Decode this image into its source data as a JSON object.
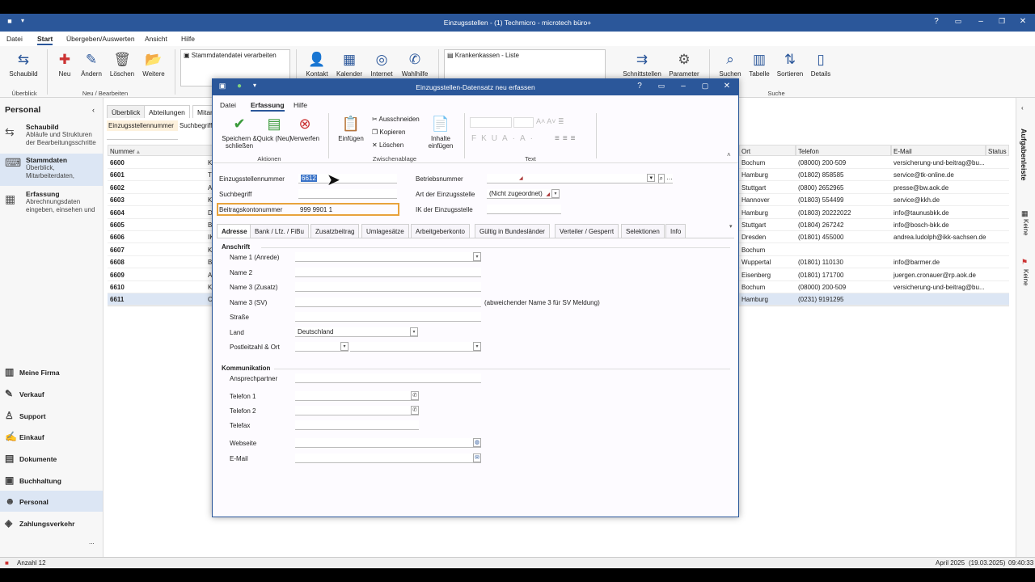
{
  "window": {
    "title": "Einzugsstellen - (1) Techmicro - microtech büro+",
    "help": "?"
  },
  "menu": {
    "items": [
      "Datei",
      "Start",
      "Übergeben/Auswerten",
      "Ansicht",
      "Hilfe"
    ]
  },
  "ribbon": {
    "schaubild": "Schaubild",
    "neu": "Neu",
    "aendern": "Ändern",
    "loeschen": "Löschen",
    "weitere": "Weitere",
    "group_ueberblick": "Überblick",
    "group_neu": "Neu / Bearbeiten",
    "listbox1_item": "Stammdatendatei verarbeiten",
    "kontakt": "Kontakt",
    "kalender": "Kalender",
    "internet": "Internet",
    "wahlhilfe": "Wahlhilfe",
    "listbox2_item": "Krankenkassen - Liste",
    "schnittstellen": "Schnittstellen",
    "parameter": "Parameter",
    "suchen": "Suchen",
    "tabelle": "Tabelle",
    "sortieren": "Sortieren",
    "details": "Details",
    "group_suche": "Suche"
  },
  "sidebar": {
    "heading": "Personal",
    "sections": [
      {
        "title": "Schaubild",
        "sub": "Abläufe und Strukturen der Bearbeitungsschritte"
      },
      {
        "title": "Stammdaten",
        "sub": "Überblick, Mitarbeiterdaten,"
      },
      {
        "title": "Erfassung",
        "sub": "Abrechnungsdaten eingeben, einsehen und"
      }
    ],
    "nav": [
      "Meine Firma",
      "Verkauf",
      "Support",
      "Einkauf",
      "Dokumente",
      "Buchhaltung",
      "Personal",
      "Zahlungsverkehr"
    ],
    "more": "..."
  },
  "main": {
    "tabs": [
      "Überblick",
      "Abteilungen",
      "Mitar"
    ],
    "filter_labels": [
      "Einzugsstellennummer",
      "Suchbegriff"
    ],
    "columns": {
      "nummer": "Nummer",
      "ort": "Ort",
      "telefon": "Telefon",
      "email": "E-Mail",
      "status": "Status"
    },
    "rows": [
      {
        "nummer": "6600",
        "k": "K",
        "ort": "Bochum",
        "telefon": "(08000) 200-509",
        "email": "versicherung-und-beitrag@bu..."
      },
      {
        "nummer": "6601",
        "k": "T",
        "ort": "Hamburg",
        "telefon": "(01802) 858585",
        "email": "service@tk-online.de"
      },
      {
        "nummer": "6602",
        "k": "A",
        "ort": "Stuttgart",
        "telefon": "(0800) 2652965",
        "email": "presse@bw.aok.de"
      },
      {
        "nummer": "6603",
        "k": "K",
        "ort": "Hannover",
        "telefon": "(01803) 554499",
        "email": "service@kkh.de"
      },
      {
        "nummer": "6604",
        "k": "D",
        "ort": "Hamburg",
        "telefon": "(01803) 20222022",
        "email": "info@taunusbkk.de"
      },
      {
        "nummer": "6605",
        "k": "B",
        "ort": "Stuttgart",
        "telefon": "(01804) 267242",
        "email": "info@bosch-bkk.de"
      },
      {
        "nummer": "6606",
        "k": "IK",
        "ort": "Dresden",
        "telefon": "(01801) 455000",
        "email": "andrea.ludolph@ikk-sachsen.de"
      },
      {
        "nummer": "6607",
        "k": "K",
        "ort": "Bochum",
        "telefon": "",
        "email": ""
      },
      {
        "nummer": "6608",
        "k": "B",
        "ort": "Wuppertal",
        "telefon": "(01801) 110130",
        "email": "info@barmer.de"
      },
      {
        "nummer": "6609",
        "k": "A",
        "ort": "Eisenberg",
        "telefon": "(01801) 171700",
        "email": "juergen.cronauer@rp.aok.de"
      },
      {
        "nummer": "6610",
        "k": "K",
        "ort": "Bochum",
        "telefon": "(08000) 200-509",
        "email": "versicherung-und-beitrag@bu..."
      },
      {
        "nummer": "6611",
        "k": "C",
        "ort": "Hamburg",
        "telefon": "(0231) 9191295",
        "email": ""
      }
    ]
  },
  "rightpanel": {
    "aufgabenleiste": "Aufgabenleiste",
    "keine1": "Keine",
    "keine2": "Keine"
  },
  "statusbar": {
    "anzahl": "Anzahl 12",
    "period": "April 2025",
    "date": "(19.03.2025)",
    "time": "09:40:33"
  },
  "dialog": {
    "title": "Einzugsstellen-Datensatz neu erfassen",
    "help": "?",
    "menu": [
      "Datei",
      "Erfassung",
      "Hilfe"
    ],
    "ribbon": {
      "speichern": "Speichern & schließen",
      "quick": "Quick (Neu)",
      "verwerfen": "Verwerfen",
      "group_aktionen": "Aktionen",
      "einfuegen": "Einfügen",
      "ausschneiden": "Ausschneiden",
      "kopieren": "Kopieren",
      "loeschen": "Löschen",
      "inhalte": "Inhalte einfügen",
      "group_zwischenablage": "Zwischenablage",
      "group_text": "Text"
    },
    "fields": {
      "einzugsstellennummer_label": "Einzugsstellennummer",
      "einzugsstellennummer_value": "6612",
      "suchbegriff_label": "Suchbegriff",
      "suchbegriff_value": "",
      "beitragskonto_label": "Beitragskontonummer",
      "beitragskonto_value": "999 9901 1",
      "betriebsnummer_label": "Betriebsnummer",
      "art_label": "Art der Einzugsstelle",
      "art_value": "(Nicht zugeordnet)",
      "ik_label": "IK der Einzugsstelle"
    },
    "tabs": [
      "Adresse",
      "Bank / Lfz. / FiBu",
      "Zusatzbeitrag",
      "Umlagesätze",
      "Arbeitgeberkonto",
      "Gültig in Bundesländer",
      "Verteiler / Gesperrt",
      "Selektionen",
      "Info"
    ],
    "anschrift": {
      "heading": "Anschrift",
      "name1": "Name 1 (Anrede)",
      "name2": "Name 2",
      "name3": "Name 3 (Zusatz)",
      "name3sv": "Name 3 (SV)",
      "name3sv_hint": "(abweichender Name 3 für SV Meldung)",
      "strasse": "Straße",
      "land": "Land",
      "land_value": "Deutschland",
      "plz": "Postleitzahl & Ort"
    },
    "kommunikation": {
      "heading": "Kommunikation",
      "ansprechpartner": "Ansprechpartner",
      "telefon1": "Telefon 1",
      "telefon2": "Telefon 2",
      "telefax": "Telefax",
      "webseite": "Webseite",
      "email": "E-Mail"
    }
  },
  "colors": {
    "accent": "#2b579a",
    "highlight": "#e8a33c",
    "selection": "#dce6f4"
  }
}
